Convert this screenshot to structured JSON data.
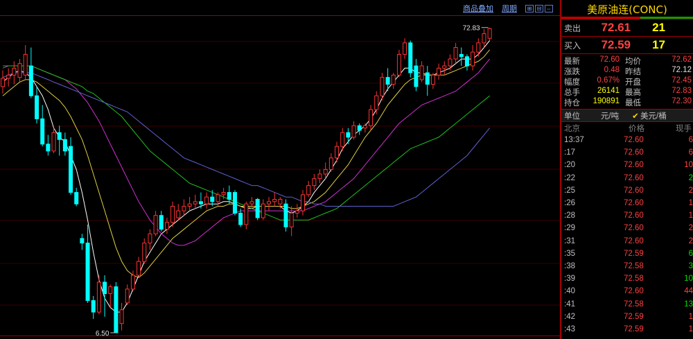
{
  "toolbar": {
    "overlay_label": "商品叠加",
    "period_label": "周期"
  },
  "chart_data": {
    "type": "candlestick",
    "title": "",
    "y_range": [
      6.2,
      75.2
    ],
    "annotations": {
      "high_label": "72.83",
      "low_label": "6.50"
    },
    "candles": [
      {
        "o": 60.0,
        "h": 63.5,
        "c": 61.8,
        "l": 58.5
      },
      {
        "o": 61.8,
        "h": 64.0,
        "c": 62.5,
        "l": 60.0
      },
      {
        "o": 62.5,
        "h": 65.5,
        "c": 64.0,
        "l": 60.5
      },
      {
        "o": 62.0,
        "h": 66.0,
        "c": 65.0,
        "l": 61.0
      },
      {
        "o": 62.5,
        "h": 69.0,
        "c": 67.0,
        "l": 61.5
      },
      {
        "o": 64.5,
        "h": 68.5,
        "c": 58.0,
        "l": 57.5
      },
      {
        "o": 58.0,
        "h": 60.0,
        "c": 53.0,
        "l": 52.0
      },
      {
        "o": 53.0,
        "h": 56.0,
        "c": 47.5,
        "l": 47.0
      },
      {
        "o": 47.5,
        "h": 49.5,
        "c": 46.0,
        "l": 45.0
      },
      {
        "o": 46.0,
        "h": 51.0,
        "c": 50.0,
        "l": 45.5
      },
      {
        "o": 50.0,
        "h": 51.5,
        "c": 48.5,
        "l": 45.0
      },
      {
        "o": 48.5,
        "h": 50.0,
        "c": 46.0,
        "l": 45.0
      },
      {
        "o": 47.0,
        "h": 49.0,
        "c": 37.0,
        "l": 36.5
      },
      {
        "o": 37.0,
        "h": 38.0,
        "c": 34.5,
        "l": 34.0
      },
      {
        "o": 27.0,
        "h": 28.0,
        "c": 26.0,
        "l": 24.5
      },
      {
        "o": 26.0,
        "h": 30.0,
        "c": 13.5,
        "l": 13.0
      },
      {
        "o": 13.5,
        "h": 14.5,
        "c": 11.0,
        "l": 9.5
      },
      {
        "o": 11.0,
        "h": 19.0,
        "c": 17.5,
        "l": 10.5
      },
      {
        "o": 17.5,
        "h": 19.0,
        "c": 15.0,
        "l": 10.0
      },
      {
        "o": 15.0,
        "h": 17.0,
        "c": 16.5,
        "l": 12.0
      },
      {
        "o": 16.5,
        "h": 17.5,
        "c": 6.5,
        "l": 6.5
      },
      {
        "o": 8.5,
        "h": 13.0,
        "c": 11.5,
        "l": 7.0
      },
      {
        "o": 13.0,
        "h": 17.0,
        "c": 16.0,
        "l": 12.5
      },
      {
        "o": 16.0,
        "h": 20.0,
        "c": 19.0,
        "l": 15.5
      },
      {
        "o": 19.0,
        "h": 23.0,
        "c": 22.0,
        "l": 18.5
      },
      {
        "o": 22.0,
        "h": 27.0,
        "c": 26.0,
        "l": 21.5
      },
      {
        "o": 26.0,
        "h": 29.0,
        "c": 28.0,
        "l": 24.5
      },
      {
        "o": 28.0,
        "h": 33.0,
        "c": 32.0,
        "l": 27.5
      },
      {
        "o": 32.0,
        "h": 33.0,
        "c": 29.0,
        "l": 28.5
      },
      {
        "o": 29.0,
        "h": 31.5,
        "c": 30.5,
        "l": 28.0
      },
      {
        "o": 30.5,
        "h": 35.0,
        "c": 34.0,
        "l": 29.5
      },
      {
        "o": 31.5,
        "h": 34.5,
        "c": 33.0,
        "l": 31.0
      },
      {
        "o": 33.0,
        "h": 35.5,
        "c": 34.0,
        "l": 32.0
      },
      {
        "o": 34.0,
        "h": 36.0,
        "c": 34.5,
        "l": 33.0
      },
      {
        "o": 34.5,
        "h": 36.5,
        "c": 35.0,
        "l": 33.5
      },
      {
        "o": 35.0,
        "h": 37.0,
        "c": 34.5,
        "l": 33.5
      },
      {
        "o": 34.5,
        "h": 37.0,
        "c": 36.0,
        "l": 33.5
      },
      {
        "o": 36.0,
        "h": 37.5,
        "c": 35.0,
        "l": 34.0
      },
      {
        "o": 35.0,
        "h": 37.0,
        "c": 36.5,
        "l": 34.0
      },
      {
        "o": 36.5,
        "h": 38.0,
        "c": 37.0,
        "l": 35.5
      },
      {
        "o": 37.0,
        "h": 38.5,
        "c": 35.5,
        "l": 34.5
      },
      {
        "o": 37.0,
        "h": 37.5,
        "c": 32.5,
        "l": 32.0
      },
      {
        "o": 32.5,
        "h": 33.5,
        "c": 30.0,
        "l": 29.5
      },
      {
        "o": 30.0,
        "h": 35.0,
        "c": 34.5,
        "l": 29.0
      },
      {
        "o": 34.5,
        "h": 36.0,
        "c": 35.0,
        "l": 33.5
      },
      {
        "o": 35.5,
        "h": 35.8,
        "c": 31.5,
        "l": 31.0
      },
      {
        "o": 31.5,
        "h": 35.5,
        "c": 34.5,
        "l": 31.0
      },
      {
        "o": 34.5,
        "h": 36.0,
        "c": 35.0,
        "l": 33.0
      },
      {
        "o": 35.0,
        "h": 37.0,
        "c": 35.5,
        "l": 34.0
      },
      {
        "o": 34.5,
        "h": 36.0,
        "c": 35.5,
        "l": 33.5
      },
      {
        "o": 34.5,
        "h": 35.5,
        "c": 29.5,
        "l": 28.5
      },
      {
        "o": 29.5,
        "h": 34.0,
        "c": 32.5,
        "l": 27.5
      },
      {
        "o": 32.5,
        "h": 34.5,
        "c": 33.0,
        "l": 31.5
      },
      {
        "o": 33.0,
        "h": 37.5,
        "c": 36.5,
        "l": 32.0
      },
      {
        "o": 36.5,
        "h": 39.5,
        "c": 38.5,
        "l": 36.0
      },
      {
        "o": 38.5,
        "h": 41.0,
        "c": 40.0,
        "l": 37.5
      },
      {
        "o": 40.0,
        "h": 42.0,
        "c": 41.0,
        "l": 39.0
      },
      {
        "o": 41.0,
        "h": 43.5,
        "c": 42.0,
        "l": 40.0
      },
      {
        "o": 42.0,
        "h": 45.5,
        "c": 44.5,
        "l": 41.5
      },
      {
        "o": 44.5,
        "h": 48.0,
        "c": 47.0,
        "l": 43.5
      },
      {
        "o": 47.0,
        "h": 51.0,
        "c": 50.0,
        "l": 46.0
      },
      {
        "o": 50.0,
        "h": 51.0,
        "c": 49.0,
        "l": 47.5
      },
      {
        "o": 49.0,
        "h": 52.5,
        "c": 51.5,
        "l": 48.5
      },
      {
        "o": 51.5,
        "h": 52.0,
        "c": 50.5,
        "l": 49.5
      },
      {
        "o": 51.0,
        "h": 52.0,
        "c": 51.5,
        "l": 50.0
      },
      {
        "o": 51.5,
        "h": 56.0,
        "c": 55.0,
        "l": 50.5
      },
      {
        "o": 55.0,
        "h": 59.0,
        "c": 58.0,
        "l": 54.0
      },
      {
        "o": 58.0,
        "h": 63.0,
        "c": 62.0,
        "l": 57.0
      },
      {
        "o": 62.0,
        "h": 64.0,
        "c": 60.5,
        "l": 59.0
      },
      {
        "o": 60.5,
        "h": 63.0,
        "c": 62.5,
        "l": 59.5
      },
      {
        "o": 62.5,
        "h": 68.0,
        "c": 67.0,
        "l": 62.0
      },
      {
        "o": 67.0,
        "h": 70.5,
        "c": 69.5,
        "l": 66.0
      },
      {
        "o": 69.5,
        "h": 70.0,
        "c": 63.0,
        "l": 62.0
      },
      {
        "o": 64.5,
        "h": 66.0,
        "c": 60.0,
        "l": 59.0
      },
      {
        "o": 61.5,
        "h": 65.5,
        "c": 64.5,
        "l": 61.0
      },
      {
        "o": 63.0,
        "h": 64.5,
        "c": 60.5,
        "l": 58.0
      },
      {
        "o": 60.5,
        "h": 63.0,
        "c": 62.5,
        "l": 59.5
      },
      {
        "o": 62.5,
        "h": 65.0,
        "c": 64.0,
        "l": 61.5
      },
      {
        "o": 64.0,
        "h": 65.5,
        "c": 64.5,
        "l": 62.5
      },
      {
        "o": 64.5,
        "h": 67.0,
        "c": 66.0,
        "l": 63.5
      },
      {
        "o": 66.0,
        "h": 69.5,
        "c": 68.5,
        "l": 65.0
      },
      {
        "o": 67.0,
        "h": 68.5,
        "c": 66.5,
        "l": 64.5
      },
      {
        "o": 66.5,
        "h": 67.0,
        "c": 64.5,
        "l": 63.5
      },
      {
        "o": 64.5,
        "h": 69.0,
        "c": 67.5,
        "l": 63.5
      },
      {
        "o": 67.5,
        "h": 70.5,
        "c": 69.5,
        "l": 66.5
      },
      {
        "o": 69.5,
        "h": 72.5,
        "c": 71.5,
        "l": 68.5
      },
      {
        "o": 70.5,
        "h": 72.83,
        "c": 72.6,
        "l": 70.0
      }
    ],
    "ma_lines": [
      {
        "color": "#ffffff",
        "values": [
          61,
          62,
          63,
          63.5,
          63,
          62,
          60,
          58,
          55,
          51,
          49,
          48,
          45,
          42,
          37,
          31,
          24,
          18,
          14,
          12,
          11,
          11,
          13,
          16,
          19,
          22,
          24,
          26,
          28,
          29,
          30,
          31,
          32,
          33,
          33.5,
          34,
          34.5,
          34.5,
          34.5,
          35,
          35,
          34.5,
          34,
          33.5,
          33.5,
          34,
          34,
          34,
          34,
          34,
          33,
          32.5,
          33,
          34,
          35,
          37,
          38.5,
          40,
          42,
          44,
          46.5,
          48,
          49.5,
          50.5,
          51.5,
          53,
          55,
          57.5,
          59.5,
          61,
          62.5,
          64,
          64,
          63,
          63,
          62.5,
          62.5,
          63,
          63.5,
          64,
          65,
          66,
          66,
          66,
          67,
          68.5,
          70
        ]
      },
      {
        "color": "#e0d040",
        "values": [
          58,
          59,
          60,
          61,
          61.5,
          61.5,
          61,
          60,
          59,
          58,
          57,
          55.5,
          53.5,
          51,
          48.5,
          45,
          41,
          37,
          33,
          29,
          25,
          22,
          20,
          19,
          18.5,
          19.5,
          21,
          22.5,
          24,
          25.5,
          27,
          28,
          29,
          30,
          31,
          32,
          33,
          33.5,
          34,
          34,
          34.5,
          34.5,
          34,
          34,
          34,
          34,
          34,
          34,
          34,
          34,
          34,
          33.5,
          33.5,
          34,
          34.5,
          35,
          36,
          37,
          38.5,
          40,
          41.5,
          43,
          45,
          47,
          49,
          50.5,
          52,
          54,
          56,
          57.5,
          59,
          60.5,
          61.5,
          62,
          62.5,
          62.5,
          62.5,
          62.5,
          62.5,
          63,
          63.5,
          64,
          64.5,
          65,
          65.5,
          66.5,
          68
        ]
      },
      {
        "color": "#d030d0",
        "values": [
          64,
          64.5,
          64.5,
          64.5,
          64.5,
          64.5,
          64,
          63.5,
          63,
          62.5,
          62,
          61.5,
          60.5,
          59.5,
          58,
          56.5,
          54.5,
          52.5,
          50,
          47.5,
          45,
          42.5,
          40,
          37.5,
          35,
          33,
          31,
          29.5,
          28,
          27,
          26,
          25.5,
          25.5,
          26,
          26.5,
          27.5,
          28.5,
          29.5,
          30.5,
          31.5,
          32,
          32.5,
          33,
          33,
          33,
          33,
          33,
          33,
          33,
          33,
          33,
          33,
          33,
          33,
          33.5,
          34,
          34.5,
          35,
          36,
          37,
          38,
          39,
          40,
          41.5,
          43,
          44.5,
          46,
          47.5,
          49,
          50.5,
          52,
          53,
          54,
          55,
          56,
          56.5,
          57,
          57.5,
          58,
          58.5,
          59,
          60,
          61,
          62,
          63,
          64.5,
          66
        ]
      },
      {
        "color": "#20c020",
        "values": [
          64.5,
          64.5,
          64.5,
          64.5,
          64.5,
          64.5,
          64,
          63.5,
          63,
          62.5,
          62,
          61.5,
          61,
          60.5,
          60,
          59,
          58.5,
          57.5,
          56.5,
          55.5,
          54.5,
          53.5,
          52,
          50.5,
          49,
          47.5,
          46,
          45,
          44,
          43,
          42,
          41,
          40,
          39,
          38.5,
          38,
          37.5,
          37,
          36.5,
          36,
          35.5,
          35,
          34.5,
          34,
          33.5,
          33,
          32.5,
          32,
          31.5,
          31,
          31,
          31,
          31,
          31,
          31,
          31.5,
          32,
          32.5,
          33,
          33.5,
          34.5,
          35.5,
          36.5,
          37.5,
          38.5,
          39.5,
          40.5,
          41.5,
          42.5,
          43.5,
          44.5,
          45.5,
          46.5,
          47,
          47.5,
          48,
          48.5,
          49,
          50,
          51,
          52,
          53,
          54,
          55,
          56,
          57,
          58
        ]
      },
      {
        "color": "#6060d0",
        "values": [
          62,
          62.5,
          63,
          63,
          63,
          63,
          62.5,
          62,
          61.5,
          61,
          60.5,
          60,
          59.5,
          59,
          58.5,
          58,
          57.5,
          57,
          56.5,
          56,
          55.5,
          55,
          54.5,
          53.5,
          52.5,
          51.5,
          50.5,
          49.5,
          48.5,
          47.5,
          46.5,
          45.5,
          44.5,
          44,
          43.5,
          43,
          42.5,
          42,
          41.5,
          41,
          40.5,
          40,
          39.5,
          39,
          38.5,
          38.5,
          38,
          37.5,
          37,
          36.5,
          36,
          36,
          35.5,
          35,
          35,
          34.5,
          34.5,
          34,
          34,
          34,
          34,
          34,
          34,
          34,
          34,
          34,
          34,
          34,
          34,
          34,
          34.5,
          35,
          35.5,
          36,
          37,
          38,
          39,
          40,
          41,
          42,
          43,
          44,
          45,
          46.5,
          48,
          49.5,
          51
        ]
      }
    ]
  },
  "panel": {
    "title": "美原油连(CONC)",
    "ask": {
      "label": "卖出",
      "price": "72.61",
      "volume": "21"
    },
    "bid": {
      "label": "买入",
      "price": "72.59",
      "volume": "17"
    },
    "stats": [
      {
        "l1": "最新",
        "v1": "72.60",
        "c1": "red",
        "l2": "均价",
        "v2": "72.62",
        "c2": "red"
      },
      {
        "l1": "涨跌",
        "v1": "0.48",
        "c1": "red",
        "l2": "昨结",
        "v2": "72.12",
        "c2": "white"
      },
      {
        "l1": "幅度",
        "v1": "0.67%",
        "c1": "red",
        "l2": "开盘",
        "v2": "72.45",
        "c2": "red"
      },
      {
        "l1": "总手",
        "v1": "26141",
        "c1": "yellow",
        "l2": "最高",
        "v2": "72.83",
        "c2": "red"
      },
      {
        "l1": "持仓",
        "v1": "190891",
        "c1": "yellow",
        "l2": "最低",
        "v2": "72.30",
        "c2": "red"
      }
    ],
    "unit": {
      "label": "单位",
      "value": "元/吨",
      "currency": "美元/桶"
    },
    "ticks_header": {
      "time": "北京",
      "price": "价格",
      "volume": "现手"
    },
    "ticks": [
      {
        "t": "13:37",
        "p": "72.60",
        "v": "6",
        "pd": "up",
        "vd": "up"
      },
      {
        "t": ":17",
        "p": "72.60",
        "v": "6",
        "pd": "up",
        "vd": "up"
      },
      {
        "t": ":20",
        "p": "72.60",
        "v": "10",
        "pd": "up",
        "vd": "up"
      },
      {
        "t": ":22",
        "p": "72.60",
        "v": "2",
        "pd": "up",
        "vd": "down"
      },
      {
        "t": ":25",
        "p": "72.60",
        "v": "2",
        "pd": "up",
        "vd": "up"
      },
      {
        "t": ":26",
        "p": "72.60",
        "v": "1",
        "pd": "up",
        "vd": "up"
      },
      {
        "t": ":28",
        "p": "72.60",
        "v": "1",
        "pd": "up",
        "vd": "up"
      },
      {
        "t": ":29",
        "p": "72.60",
        "v": "2",
        "pd": "up",
        "vd": "up"
      },
      {
        "t": ":31",
        "p": "72.60",
        "v": "2",
        "pd": "up",
        "vd": "up"
      },
      {
        "t": ":35",
        "p": "72.59",
        "v": "6",
        "pd": "up",
        "vd": "down"
      },
      {
        "t": ":38",
        "p": "72.58",
        "v": "3",
        "pd": "up",
        "vd": "down"
      },
      {
        "t": ":39",
        "p": "72.58",
        "v": "10",
        "pd": "up",
        "vd": "down"
      },
      {
        "t": ":40",
        "p": "72.60",
        "v": "44",
        "pd": "up",
        "vd": "up"
      },
      {
        "t": ":41",
        "p": "72.58",
        "v": "13",
        "pd": "up",
        "vd": "down"
      },
      {
        "t": ":42",
        "p": "72.59",
        "v": "1",
        "pd": "up",
        "vd": "up"
      },
      {
        "t": ":43",
        "p": "72.59",
        "v": "1",
        "pd": "up",
        "vd": "up"
      }
    ]
  }
}
